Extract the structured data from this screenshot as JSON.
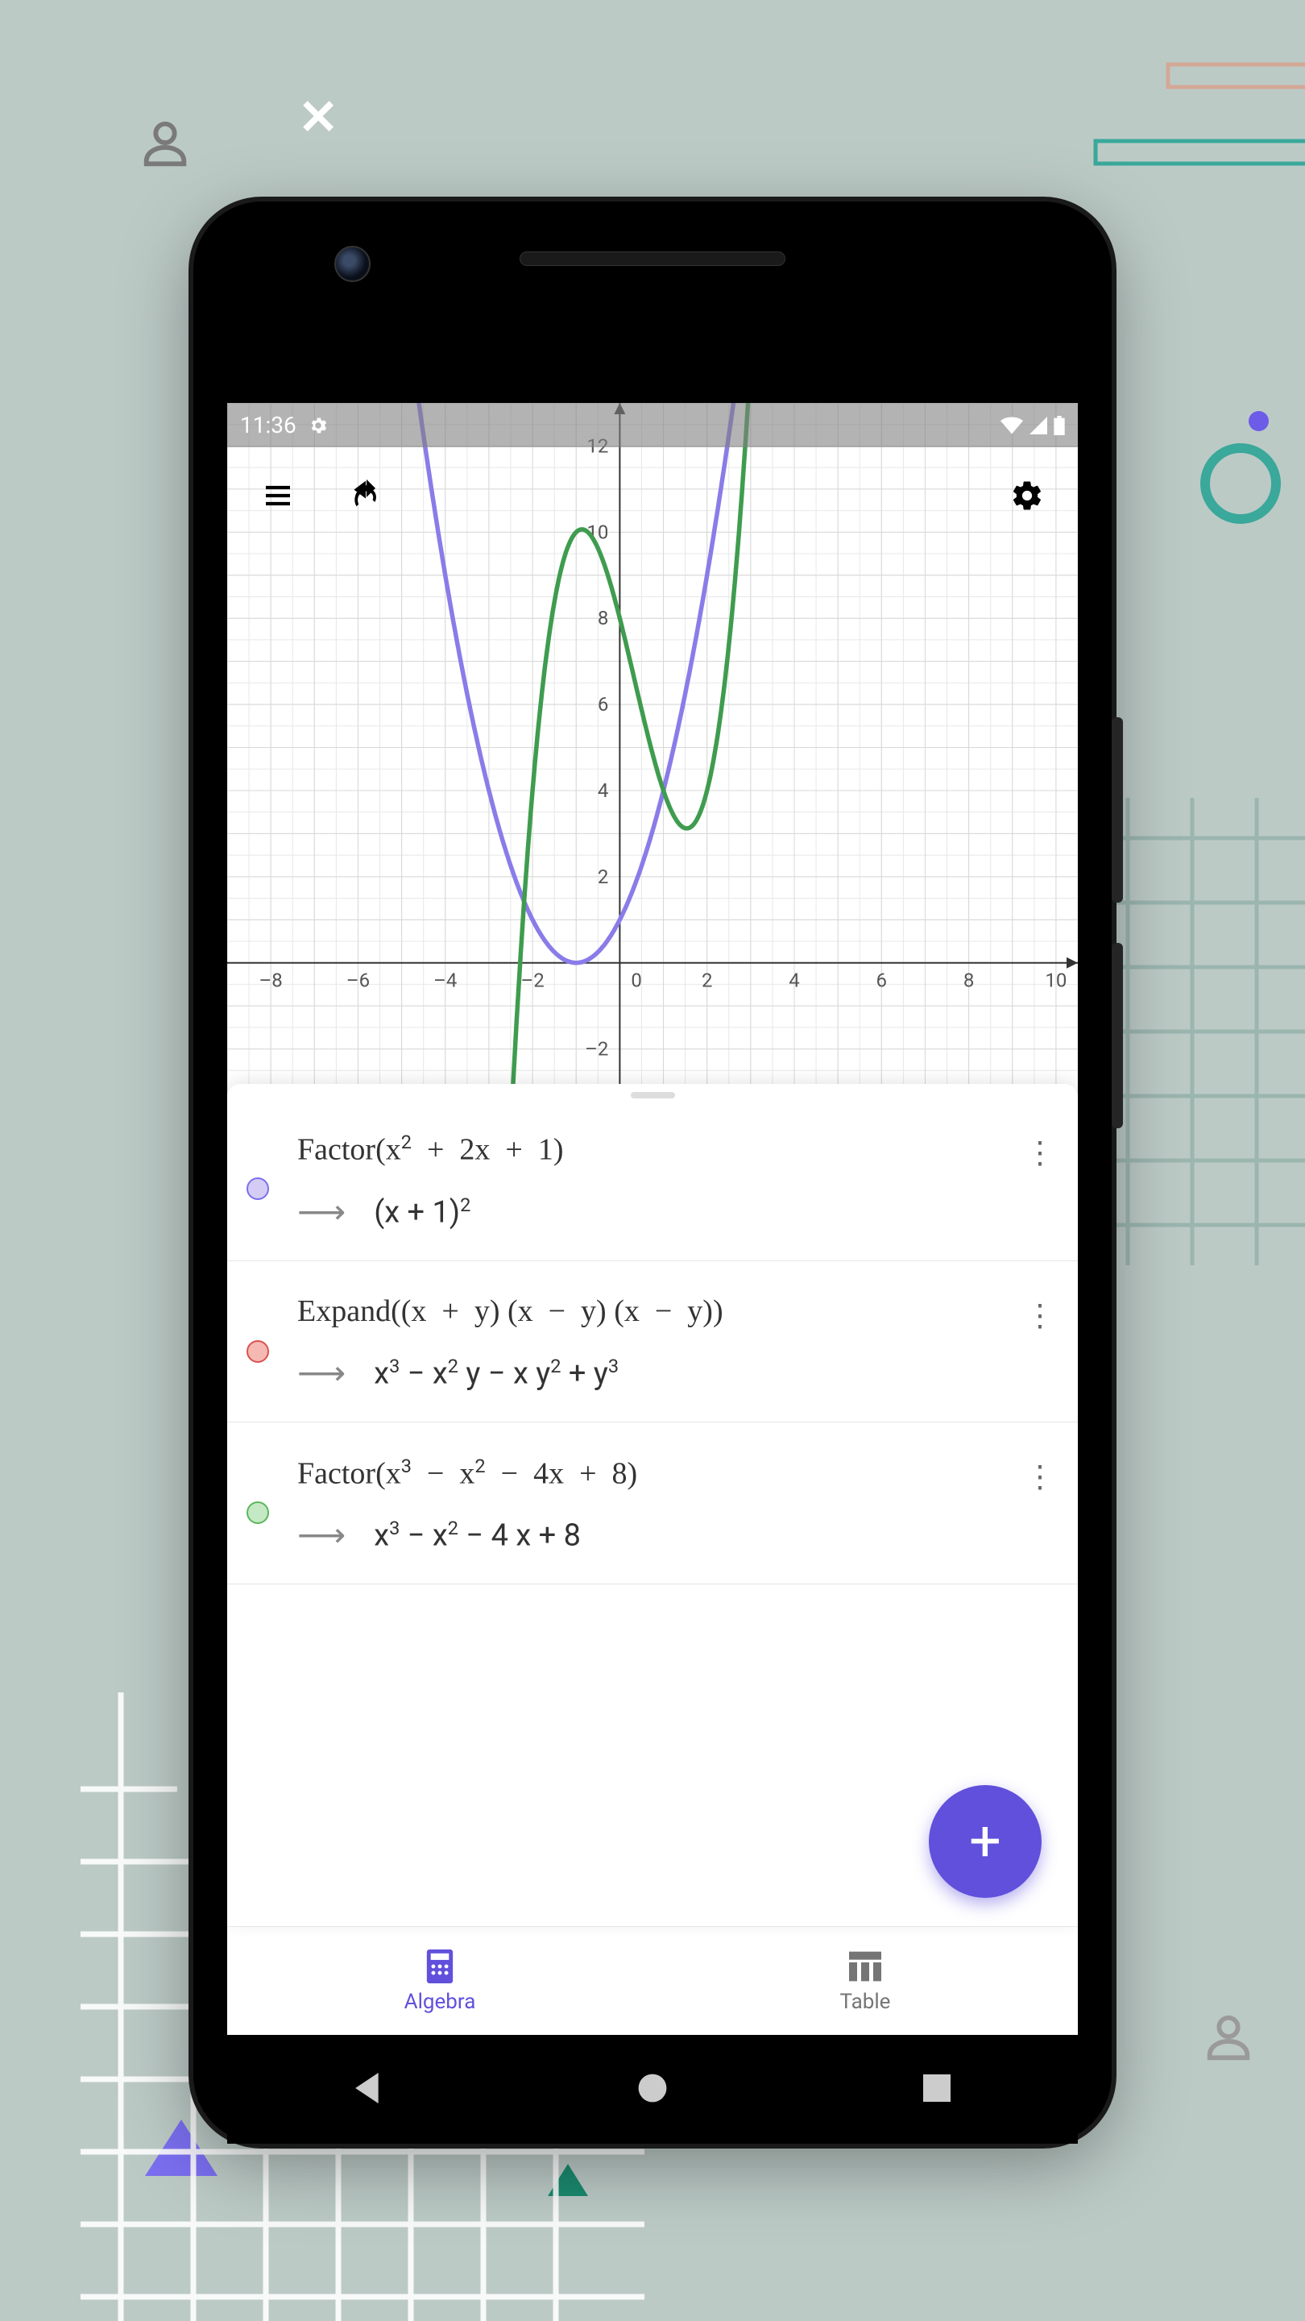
{
  "statusbar": {
    "time": "11:36"
  },
  "chart_data": {
    "type": "line",
    "xlim": [
      -9,
      10.5
    ],
    "ylim": [
      -3,
      13
    ],
    "xticks": [
      -8,
      -6,
      -4,
      -2,
      0,
      2,
      4,
      6,
      8,
      10
    ],
    "yticks": [
      -2,
      2,
      4,
      6,
      8,
      10,
      12
    ],
    "series": [
      {
        "name": "Factor(x²+2x+1)",
        "color": "#8a7ce8",
        "expr": "(x+1)^2"
      },
      {
        "name": "Factor(x³-x²-4x+8)",
        "color": "#3f9c4f",
        "expr": "x^3-x^2-4x+8"
      }
    ]
  },
  "items": [
    {
      "color": "purple",
      "input": "Factor(x² + 2x + 1)",
      "output": "(x + 1)²"
    },
    {
      "color": "red",
      "input": "Expand((x + y) (x − y) (x − y))",
      "output": "x³ − x² y − x y² + y³"
    },
    {
      "color": "green",
      "input": "Factor(x³ − x² − 4x + 8)",
      "output": "x³ − x² − 4 x + 8"
    }
  ],
  "tabs": {
    "algebra": "Algebra",
    "table": "Table"
  },
  "fab": "+",
  "icons": {
    "menu": "menu-icon",
    "undo": "undo-icon",
    "settings": "gear-icon"
  }
}
